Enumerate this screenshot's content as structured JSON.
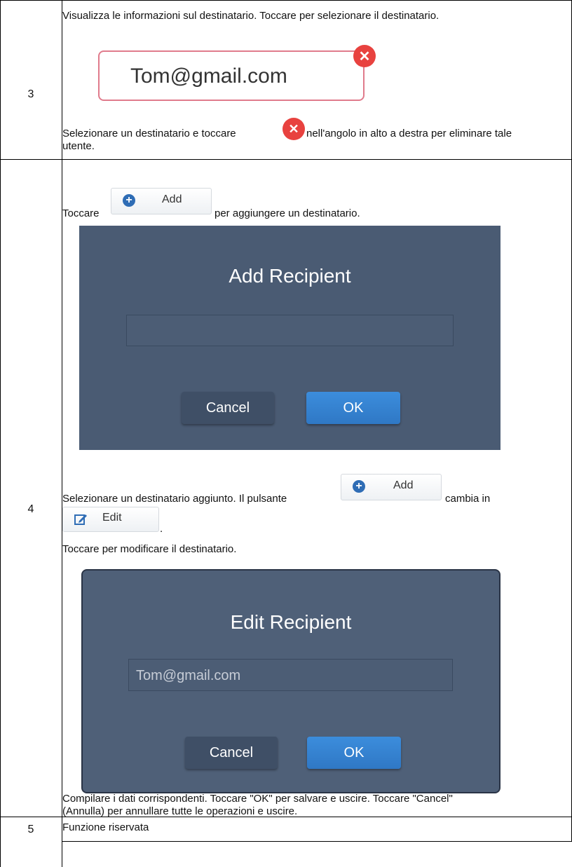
{
  "rows": [
    {
      "number": "3",
      "intro": "Visualizza le informazioni sul destinatario. Toccare per selezionare il destinatario.",
      "chip_email": "Tom@gmail.com",
      "delete_text_before": "Selezionare un destinatario e toccare",
      "delete_text_after": "nell'angolo in alto a destra per eliminare tale",
      "delete_text_line2": "utente."
    },
    {
      "number": "4",
      "tap_prefix": "Toccare",
      "add_suffix": "per aggiungere un destinatario.",
      "add_button_label": "Add",
      "add_dialog": {
        "title": "Add Recipient",
        "input_value": "",
        "cancel": "Cancel",
        "ok": "OK"
      },
      "select_text": "Selezionare un destinatario aggiunto. Il pulsante",
      "changes_to": "cambia in",
      "edit_button_label": "Edit",
      "period": ".",
      "edit_instruction": "Toccare per modificare il destinatario.",
      "edit_dialog": {
        "title": "Edit Recipient",
        "input_value": "Tom@gmail.com",
        "cancel": "Cancel",
        "ok": "OK"
      },
      "footer_line1": "Compilare i dati corrispondenti. Toccare \"OK\" per salvare e uscire. Toccare \"Cancel\"",
      "footer_line2": "(Annulla) per annullare tutte le operazioni e uscire."
    },
    {
      "number": "5",
      "text": "Funzione riservata"
    }
  ]
}
